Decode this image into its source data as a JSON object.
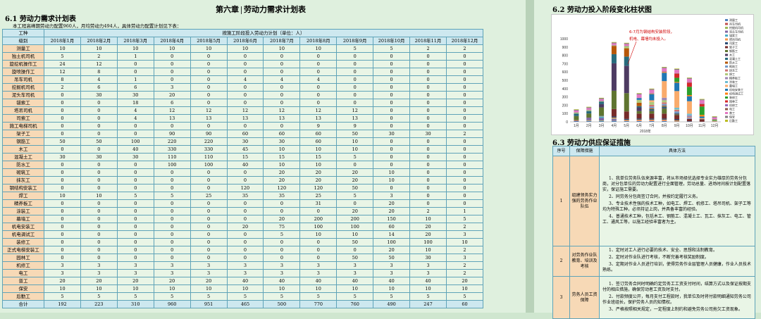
{
  "chapter": {
    "no": "第六章",
    "title": "劳动力需求计划表"
  },
  "section1": {
    "title": "6.1 劳动力需求计划表",
    "intro": "本工程高峰期劳动力配置960人，月均劳动力494人，具体劳动力配置计划见下表：",
    "col_worker": "工种",
    "col_level": "级别",
    "group_header": "按施工阶段投入劳动力计划（单位：人）",
    "months": [
      "2018年1月",
      "2018年2月",
      "2018年3月",
      "2018年4月",
      "2018年5月",
      "2018年6月",
      "2018年7月",
      "2018年8月",
      "2018年9月",
      "2018年10月",
      "2018年11月",
      "2018年12月"
    ],
    "rows": [
      {
        "name": "测量工",
        "values": [
          "10",
          "10",
          "10",
          "10",
          "10",
          "10",
          "10",
          "10",
          "5",
          "5",
          "2",
          "2"
        ]
      },
      {
        "name": "独土机司机",
        "values": [
          "5",
          "2",
          "1",
          "0",
          "0",
          "0",
          "0",
          "0",
          "0",
          "0",
          "0",
          "0"
        ]
      },
      {
        "name": "旋挖机操作工",
        "values": [
          "24",
          "12",
          "0",
          "0",
          "0",
          "0",
          "0",
          "0",
          "0",
          "0",
          "0",
          "0"
        ]
      },
      {
        "name": "旋喷操作工",
        "values": [
          "12",
          "8",
          "0",
          "0",
          "0",
          "0",
          "0",
          "0",
          "0",
          "0",
          "0",
          "0"
        ]
      },
      {
        "name": "吊车司机",
        "values": [
          "8",
          "4",
          "1",
          "0",
          "0",
          "4",
          "4",
          "4",
          "0",
          "0",
          "0",
          "0"
        ]
      },
      {
        "name": "挖掘机司机",
        "values": [
          "2",
          "6",
          "6",
          "3",
          "0",
          "0",
          "0",
          "0",
          "0",
          "0",
          "0",
          "0"
        ]
      },
      {
        "name": "泥头车司机",
        "values": [
          "0",
          "30",
          "30",
          "20",
          "0",
          "0",
          "0",
          "0",
          "0",
          "0",
          "0",
          "0"
        ]
      },
      {
        "name": "锚索工",
        "values": [
          "0",
          "0",
          "18",
          "6",
          "0",
          "0",
          "0",
          "0",
          "0",
          "0",
          "0",
          "0"
        ]
      },
      {
        "name": "塔吊司机",
        "values": [
          "0",
          "0",
          "4",
          "12",
          "12",
          "12",
          "12",
          "12",
          "12",
          "0",
          "0",
          "0"
        ]
      },
      {
        "name": "司索工",
        "values": [
          "0",
          "0",
          "4",
          "13",
          "13",
          "13",
          "13",
          "13",
          "13",
          "0",
          "0",
          "0"
        ]
      },
      {
        "name": "施工电梯司机",
        "values": [
          "0",
          "0",
          "0",
          "0",
          "0",
          "0",
          "0",
          "9",
          "9",
          "0",
          "0",
          "0"
        ]
      },
      {
        "name": "架子工",
        "values": [
          "0",
          "0",
          "0",
          "90",
          "90",
          "60",
          "60",
          "60",
          "50",
          "30",
          "30",
          "2"
        ]
      },
      {
        "name": "钢筋工",
        "values": [
          "50",
          "50",
          "100",
          "220",
          "220",
          "30",
          "30",
          "60",
          "10",
          "0",
          "0",
          "0"
        ]
      },
      {
        "name": "木工",
        "values": [
          "0",
          "0",
          "40",
          "330",
          "330",
          "45",
          "10",
          "10",
          "10",
          "0",
          "0",
          "0"
        ]
      },
      {
        "name": "混凝土工",
        "values": [
          "30",
          "30",
          "30",
          "110",
          "110",
          "15",
          "15",
          "15",
          "5",
          "0",
          "0",
          "0"
        ]
      },
      {
        "name": "防水工",
        "values": [
          "0",
          "0",
          "0",
          "100",
          "100",
          "40",
          "10",
          "10",
          "0",
          "0",
          "0",
          "0"
        ]
      },
      {
        "name": "砌筑工",
        "values": [
          "0",
          "0",
          "0",
          "0",
          "0",
          "0",
          "20",
          "20",
          "20",
          "10",
          "0",
          "0"
        ]
      },
      {
        "name": "抹灰工",
        "values": [
          "0",
          "0",
          "0",
          "0",
          "0",
          "0",
          "20",
          "20",
          "20",
          "10",
          "0",
          "0"
        ]
      },
      {
        "name": "钢结构安装工",
        "values": [
          "0",
          "0",
          "0",
          "0",
          "0",
          "120",
          "120",
          "120",
          "50",
          "0",
          "0",
          "0"
        ]
      },
      {
        "name": "焊工",
        "values": [
          "10",
          "10",
          "5",
          "5",
          "25",
          "35",
          "35",
          "25",
          "5",
          "3",
          "0",
          "0"
        ]
      },
      {
        "name": "精养板工",
        "values": [
          "0",
          "0",
          "0",
          "0",
          "0",
          "0",
          "0",
          "31",
          "0",
          "20",
          "0",
          "0"
        ]
      },
      {
        "name": "涂装工",
        "values": [
          "0",
          "0",
          "0",
          "0",
          "0",
          "0",
          "0",
          "0",
          "20",
          "20",
          "2",
          "1"
        ]
      },
      {
        "name": "幕墙工",
        "values": [
          "0",
          "0",
          "0",
          "0",
          "0",
          "0",
          "20",
          "200",
          "200",
          "150",
          "10",
          "5"
        ]
      },
      {
        "name": "机电安装工",
        "values": [
          "0",
          "0",
          "0",
          "0",
          "0",
          "20",
          "75",
          "100",
          "100",
          "60",
          "20",
          "2"
        ]
      },
      {
        "name": "机电调试工",
        "values": [
          "0",
          "0",
          "0",
          "0",
          "0",
          "0",
          "5",
          "10",
          "10",
          "14",
          "20",
          "3"
        ]
      },
      {
        "name": "装修工",
        "values": [
          "0",
          "0",
          "0",
          "0",
          "0",
          "0",
          "0",
          "0",
          "50",
          "100",
          "100",
          "10"
        ]
      },
      {
        "name": "正式电梯安装工",
        "values": [
          "0",
          "0",
          "0",
          "0",
          "0",
          "0",
          "0",
          "0",
          "0",
          "20",
          "10",
          "2"
        ]
      },
      {
        "name": "园林工",
        "values": [
          "0",
          "0",
          "0",
          "0",
          "0",
          "0",
          "0",
          "0",
          "50",
          "50",
          "30",
          "3"
        ]
      },
      {
        "name": "机修工",
        "values": [
          "3",
          "3",
          "3",
          "3",
          "3",
          "3",
          "3",
          "3",
          "3",
          "3",
          "3",
          "2"
        ]
      },
      {
        "name": "电工",
        "values": [
          "3",
          "3",
          "3",
          "3",
          "3",
          "3",
          "3",
          "3",
          "3",
          "3",
          "3",
          "2"
        ]
      },
      {
        "name": "普工",
        "values": [
          "20",
          "20",
          "20",
          "20",
          "20",
          "40",
          "40",
          "40",
          "40",
          "40",
          "40",
          "20"
        ]
      },
      {
        "name": "保安",
        "values": [
          "10",
          "10",
          "10",
          "10",
          "10",
          "10",
          "10",
          "10",
          "10",
          "10",
          "10",
          "10"
        ]
      },
      {
        "name": "后勤工",
        "values": [
          "5",
          "5",
          "5",
          "5",
          "5",
          "5",
          "5",
          "5",
          "5",
          "5",
          "5",
          "5"
        ]
      },
      {
        "name": "合计",
        "values": [
          "192",
          "223",
          "310",
          "960",
          "951",
          "465",
          "500",
          "770",
          "760",
          "490",
          "247",
          "60"
        ]
      }
    ]
  },
  "section2": {
    "title": "6.2 劳动力投入阶段变化柱状图",
    "chart_data": {
      "type": "bar",
      "stacked": true,
      "categories": [
        "1月",
        "2月",
        "3月",
        "4月",
        "5月",
        "6月",
        "7月",
        "8月",
        "9月",
        "10月",
        "11月",
        "12月"
      ],
      "values": [
        192,
        223,
        310,
        960,
        951,
        465,
        500,
        770,
        760,
        490,
        247,
        60
      ],
      "xlabel": "2018年",
      "ylim": [
        0,
        1000
      ],
      "yticks": [
        "0",
        "100",
        "200",
        "300",
        "400",
        "500",
        "600",
        "700",
        "800",
        "900",
        "1000"
      ],
      "annotation": "6-7月为钢结构安装阶段，机电、幕墙均未投入。",
      "legend": [
        "测量工",
        "吊车司机",
        "挖掘机司机",
        "泥头车司机",
        "锚索工",
        "塔吊司机",
        "司索工",
        "架子工",
        "钢筋工",
        "木工",
        "混凝土工",
        "防水工",
        "砌筑工",
        "抹灰工",
        "焊工",
        "精养板工",
        "涂装工",
        "幕墙工",
        "机电安装工",
        "机电调试工",
        "装修工",
        "园林工",
        "机修工",
        "电工",
        "普工",
        "保安",
        "后勤工"
      ],
      "colors": [
        "#4f81bd",
        "#c0504d",
        "#9bbb59",
        "#8064a2",
        "#4bacc6",
        "#f79646",
        "#2c4d75",
        "#772c2a",
        "#5f7530",
        "#4d3b62",
        "#276a7c",
        "#b65708",
        "#729aca",
        "#cd7371",
        "#afc97a",
        "#9d88b4",
        "#6fbdd1",
        "#f9ab6b",
        "#1f77b4",
        "#ff7f0e",
        "#2ca02c",
        "#d62728",
        "#9467bd",
        "#8c564b",
        "#e377c2",
        "#7f7f7f",
        "#bcbd22"
      ]
    }
  },
  "section3": {
    "title": "6.3 劳动力供应保证措施",
    "headers": [
      "序号",
      "保障措施",
      "具体方法"
    ],
    "rows": [
      {
        "no": "1",
        "measure": "组建领务实力强的劳务作业队伍",
        "methods": [
          "1、我单位劳务队伍来源丰富，将从市场择优选择专业实力雄厚的劳务分包商，对分包单位的劳动力配置进行全面管理，劳动总量、进场时间按计划配置落实，保证施工需要。",
          "2、同劳务分包商签订合同，并按约定履行义务。",
          "3、专业技术性强的技术工种，如电工、焊工、机修工、塔吊司机、架子工等均为特殊工种，必须持证上岗，并具备丰富的经验。",
          "4、普通技术工种，包括木工、钢筋工、混凝土工、瓦工、抹灰工、电工、管工、通风工等，以施工经验丰富者为主。"
        ]
      },
      {
        "no": "2",
        "measure": "对劳务作业队教育、培训及考核",
        "methods": [
          "1、定时对工人进行必要的技术、安全、思想和法制教育。",
          "2、定时对作业队进行考核，不断完善考核奖励制度。",
          "3、定期对作业人员进行培训，使得劳务作业层管理人员健康，作业人员技术熟练。"
        ]
      },
      {
        "no": "3",
        "measure": "劳务人员工资保障",
        "methods": [
          "1、签订劳务合同时明确约定劳务工工资支付时间，结算方式以及保证按期支付的相应措施，确保劳动者工资及时支付。",
          "2、付款频度公开，每月支付工程款时，我单位及时将付款明细通知劳务公司作业班组长，保护劳务人员的知情权。",
          "3、严格按照相关规定，一定程度上制约和避免劳务公司拖欠工资现象。"
        ]
      }
    ]
  }
}
